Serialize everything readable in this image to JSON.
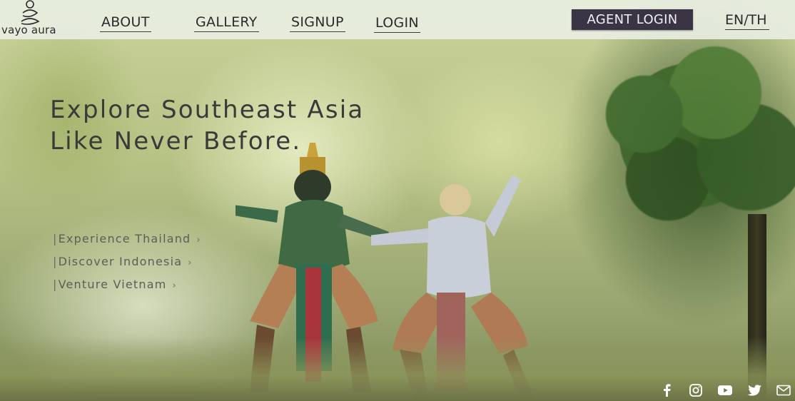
{
  "brand": {
    "name": "vayo aura"
  },
  "nav": {
    "links": [
      {
        "label": "ABOUT"
      },
      {
        "label": "GALLERY"
      },
      {
        "label": "SIGNUP"
      },
      {
        "label": "LOGIN"
      }
    ],
    "agent_login_label": "AGENT LOGIN",
    "language_label": "EN/TH"
  },
  "hero": {
    "headline_line1": "Explore Southeast Asia",
    "headline_line2": "Like Never Before.",
    "destinations": [
      {
        "label": "Experience Thailand"
      },
      {
        "label": "Discover Indonesia"
      },
      {
        "label": "Venture Vietnam"
      }
    ]
  },
  "social": {
    "icons": [
      "facebook-icon",
      "instagram-icon",
      "youtube-icon",
      "twitter-icon",
      "mail-icon"
    ]
  },
  "colors": {
    "topbar_bg": "#e8eee2",
    "agent_button_bg": "#3a3445",
    "text_dark": "#2b2b2b",
    "headline": "#3a3a3a"
  }
}
